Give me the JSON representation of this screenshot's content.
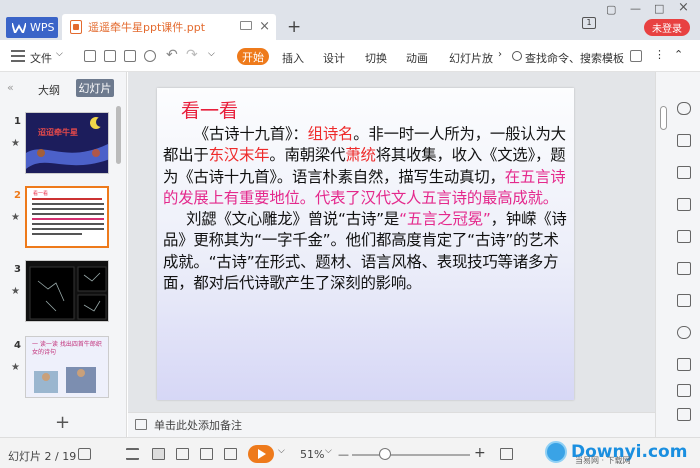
{
  "window": {
    "app_tab": "WPS",
    "doc_tab": "遥遥牵牛星ppt课件.ppt",
    "badge": "1",
    "login_button": "未登录",
    "new_tab": "+"
  },
  "toolbar": {
    "file": "文件",
    "start": "开始",
    "insert": "插入",
    "design": "设计",
    "switch": "切换",
    "animation": "动画",
    "slideshow": "幻灯片放",
    "search": "查找命令、搜索模板"
  },
  "left_panel": {
    "tab_outline": "大纲",
    "tab_slides": "幻灯片",
    "thumbnails": [
      {
        "num": "1",
        "caption": "迢迢牵牛星"
      },
      {
        "num": "2",
        "caption": "看一看"
      },
      {
        "num": "3",
        "caption": ""
      },
      {
        "num": "4",
        "caption": "一 读一读 找出四首牛郎织女的诗句"
      }
    ],
    "add": "+"
  },
  "slide": {
    "title": "看一看",
    "p1": [
      {
        "t": "《古诗十九首》：",
        "c": ""
      },
      {
        "t": "组诗名",
        "c": "red"
      },
      {
        "t": "。非一时一人所为，一般认为大都出于",
        "c": ""
      },
      {
        "t": "东汉末年",
        "c": "red"
      },
      {
        "t": "。南朝梁代",
        "c": ""
      },
      {
        "t": "萧统",
        "c": "red"
      },
      {
        "t": "将其收集，收入《文选》，题为《古诗十九首》。语言朴素自然，描写生动真切，",
        "c": ""
      },
      {
        "t": "在五言诗的发展上有重要地位。代表了汉代文人五言诗的最高成就。",
        "c": "pink"
      }
    ],
    "p2": [
      {
        "t": "刘勰《文心雕龙》曾说“古诗”是",
        "c": ""
      },
      {
        "t": "“五言之冠冕”",
        "c": "pink"
      },
      {
        "t": "，钟嵘《诗品》更称其为“一字千金”。他们都高度肯定了“古诗”的艺术成就。“古诗”在形式、题材、语言风格、表现技巧等诸多方面，都对后代诗歌产生了深刻的影响。",
        "c": ""
      }
    ]
  },
  "notes": {
    "placeholder": "单击此处添加备注"
  },
  "status": {
    "slide_counter": "幻灯片 2 / 19",
    "zoom": "51%",
    "minus": "—",
    "plus": "+"
  },
  "watermark": {
    "brand": "Downyi.com",
    "sub": "当易网 · 下载网"
  },
  "colors": {
    "accent": "#ee7a1b",
    "wps_blue": "#3a64c8",
    "red_text": "#ee2a2a",
    "pink_text": "#e4298c",
    "login_red": "#e84141"
  }
}
